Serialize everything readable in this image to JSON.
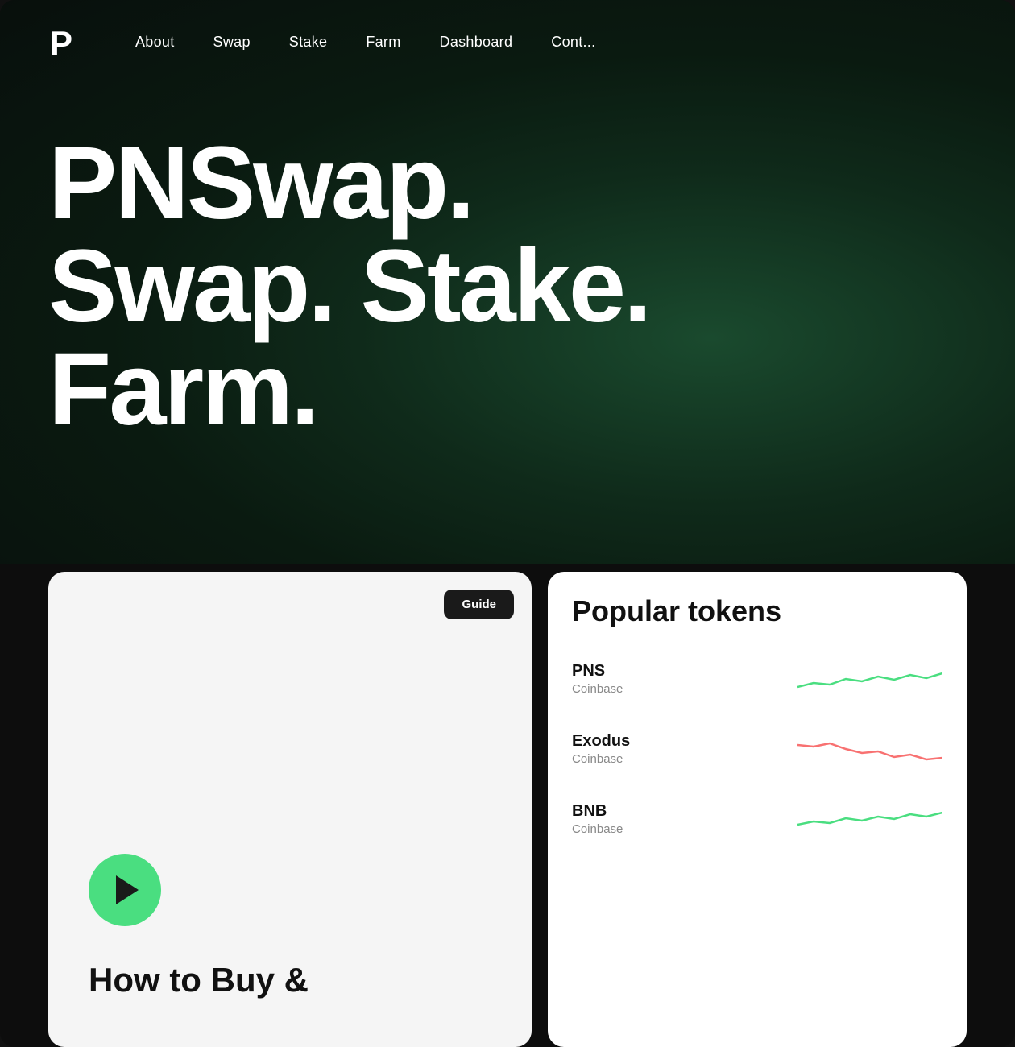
{
  "logo": {
    "alt": "PNSwap Logo",
    "symbol": "P"
  },
  "navbar": {
    "links": [
      {
        "label": "About",
        "href": "#about"
      },
      {
        "label": "Swap",
        "href": "#swap"
      },
      {
        "label": "Stake",
        "href": "#stake"
      },
      {
        "label": "Farm",
        "href": "#farm"
      },
      {
        "label": "Dashboard",
        "href": "#dashboard"
      },
      {
        "label": "Cont...",
        "href": "#contact"
      }
    ]
  },
  "hero": {
    "title_line1": "PNSwap.",
    "title_line2": "Swap. Stake.",
    "title_line3": "Farm."
  },
  "guide_card": {
    "button_label": "Guide",
    "subtitle_line1": "How to Buy &"
  },
  "tokens_card": {
    "title": "Popular tokens",
    "tokens": [
      {
        "name": "PNS",
        "exchange": "Coinbase",
        "trend": "up"
      },
      {
        "name": "Exodus",
        "exchange": "Coinbase",
        "trend": "down"
      },
      {
        "name": "BNB",
        "exchange": "Coinbase",
        "trend": "up"
      }
    ]
  }
}
